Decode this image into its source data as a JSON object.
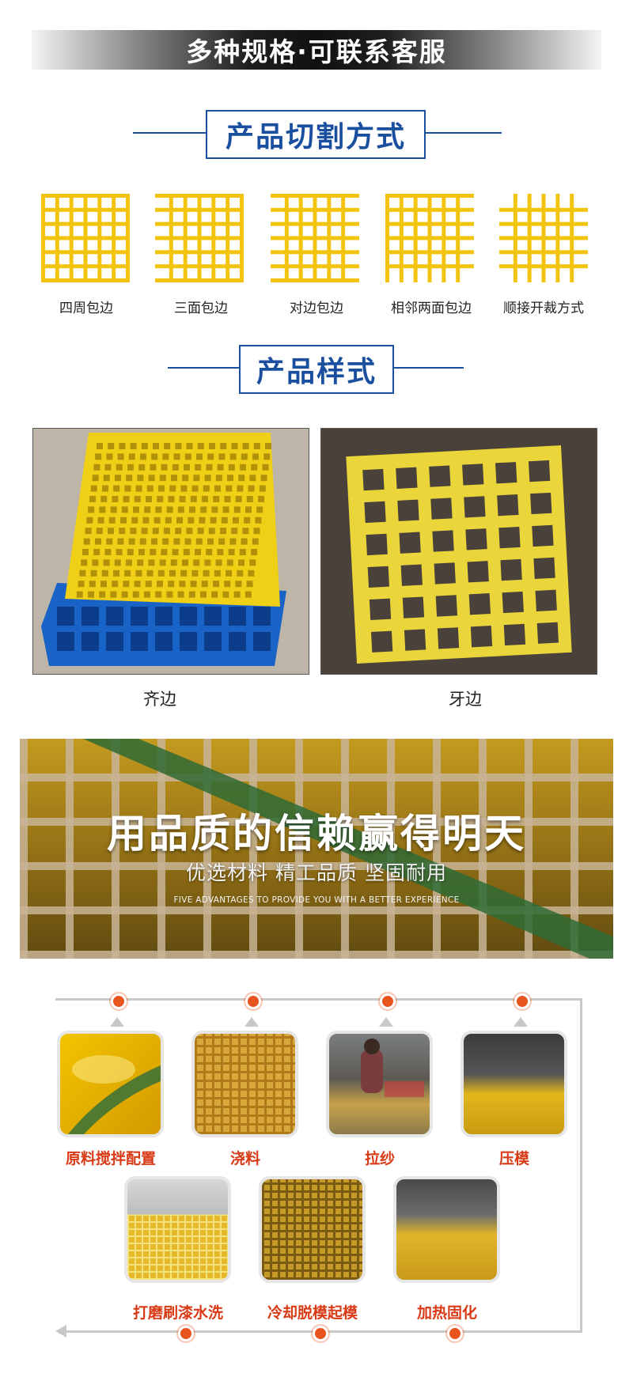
{
  "banner": {
    "title": "多种规格·可联系客服"
  },
  "cutting": {
    "title": "产品切割方式",
    "items": [
      {
        "label": "四周包边"
      },
      {
        "label": "三面包边"
      },
      {
        "label": "对边包边"
      },
      {
        "label": "相邻两面包边"
      },
      {
        "label": "顺接开裁方式"
      }
    ]
  },
  "styles": {
    "title": "产品样式",
    "items": [
      {
        "label": "齐边"
      },
      {
        "label": "牙边"
      }
    ]
  },
  "quality": {
    "title": "用品质的信赖赢得明天",
    "subtitle": "优选材料  精工品质  坚固耐用",
    "english": "FIVE ADVANTAGES TO PROVIDE YOU WITH A BETTER EXPERIENCE"
  },
  "process": {
    "steps": [
      {
        "label": "原料搅拌配置"
      },
      {
        "label": "浇料"
      },
      {
        "label": "拉纱"
      },
      {
        "label": "压模"
      },
      {
        "label": "打磨刷漆水洗"
      },
      {
        "label": "冷却脱模起模"
      },
      {
        "label": "加热固化"
      }
    ]
  },
  "colors": {
    "accent_blue": "#1a4fa0",
    "accent_orange": "#d93a16",
    "grid_yellow": "#f2c40f"
  }
}
